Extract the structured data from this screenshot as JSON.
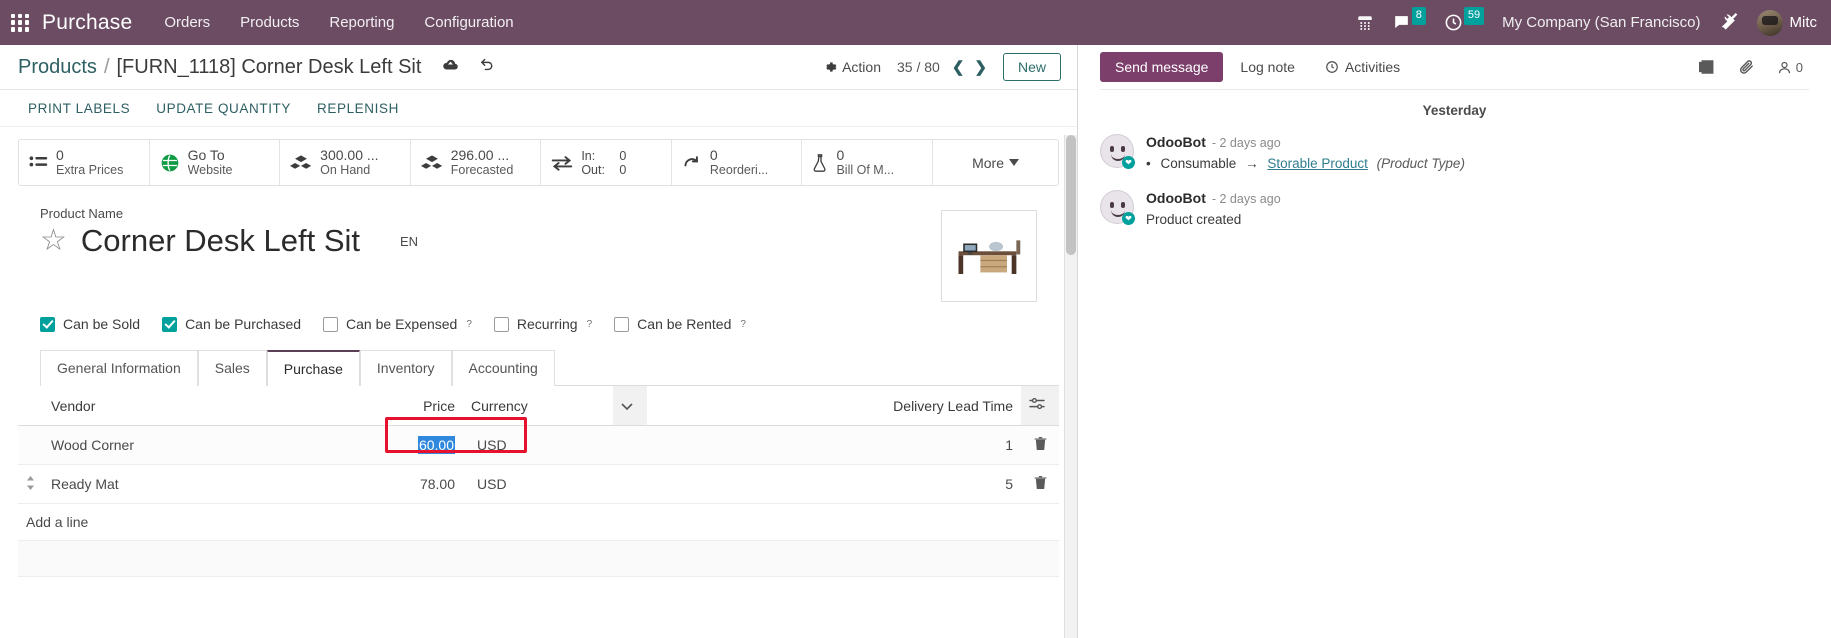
{
  "navbar": {
    "apps_icon": "apps-grid-icon",
    "brand": "Purchase",
    "menu": [
      {
        "label": "Orders"
      },
      {
        "label": "Products"
      },
      {
        "label": "Reporting"
      },
      {
        "label": "Configuration"
      }
    ],
    "phone_icon": "phone-icon",
    "messages_icon": "chat-bubble-icon",
    "messages_count": "8",
    "activities_icon": "clock-icon",
    "activities_count": "59",
    "company": "My Company (San Francisco)",
    "tools_icon": "wrench-screwdriver-icon",
    "avatar_icon": "user-avatar",
    "username": "Mitc"
  },
  "control_panel": {
    "breadcrumb_parent": "Products",
    "breadcrumb_sep": "/",
    "breadcrumb_current": "[FURN_1118] Corner Desk Left Sit",
    "save_icon": "cloud-upload-icon",
    "discard_icon": "undo-icon",
    "action_label": "Action",
    "action_icon": "gear-icon",
    "pager_value": "35 / 80",
    "prev_icon": "chevron-left-icon",
    "next_icon": "chevron-right-icon",
    "new_label": "New"
  },
  "statusbar_buttons": [
    {
      "label": "PRINT LABELS"
    },
    {
      "label": "UPDATE QUANTITY"
    },
    {
      "label": "REPLENISH"
    }
  ],
  "smart_buttons": [
    {
      "icon": "list-icon",
      "value": "0",
      "label": "Extra Prices"
    },
    {
      "icon": "globe-icon",
      "value": "Go To",
      "label": "Website"
    },
    {
      "icon": "boxes-icon",
      "value": "300.00 ...",
      "label": "On Hand"
    },
    {
      "icon": "boxes-icon",
      "value": "296.00 ...",
      "label": "Forecasted"
    },
    {
      "icon": "exchange-icon",
      "in_label": "In:",
      "in_value": "0",
      "out_label": "Out:",
      "out_value": "0"
    },
    {
      "icon": "refresh-icon",
      "value": "0",
      "label": "Reorderi..."
    },
    {
      "icon": "flask-icon",
      "value": "0",
      "label": "Bill Of M..."
    }
  ],
  "smart_more": {
    "label": "More",
    "icon": "caret-down-icon"
  },
  "product": {
    "name_label": "Product Name",
    "favorite_icon": "star-outline-icon",
    "name": "Corner Desk Left Sit",
    "language_badge": "EN",
    "image_alt": "product-photo-desk"
  },
  "checkboxes": [
    {
      "label": "Can be Sold",
      "checked": true,
      "help": ""
    },
    {
      "label": "Can be Purchased",
      "checked": true,
      "help": ""
    },
    {
      "label": "Can be Expensed",
      "checked": false,
      "help": "?"
    },
    {
      "label": "Recurring",
      "checked": false,
      "help": "?"
    },
    {
      "label": "Can be Rented",
      "checked": false,
      "help": "?"
    }
  ],
  "tabs": [
    {
      "label": "General Information",
      "active": false
    },
    {
      "label": "Sales",
      "active": false
    },
    {
      "label": "Purchase",
      "active": true
    },
    {
      "label": "Inventory",
      "active": false
    },
    {
      "label": "Accounting",
      "active": false
    }
  ],
  "vendor_list": {
    "headers": {
      "vendor": "Vendor",
      "price": "Price",
      "currency": "Currency",
      "optional_icon": "chevron-down-icon",
      "lead_time": "Delivery Lead Time",
      "settings_icon": "sliders-icon"
    },
    "rows": [
      {
        "handle_icon": "drag-handle-icon",
        "vendor": "Wood Corner",
        "price": "60.00",
        "price_selected": true,
        "currency": "USD",
        "lead_time": "1",
        "delete_icon": "trash-icon"
      },
      {
        "handle_icon": "drag-handle-icon",
        "vendor": "Ready Mat",
        "price": "78.00",
        "price_selected": false,
        "currency": "USD",
        "lead_time": "5",
        "delete_icon": "trash-icon"
      }
    ],
    "add_line_label": "Add a line"
  },
  "chatter": {
    "send_message": "Send message",
    "log_note": "Log note",
    "activities": "Activities",
    "activities_icon": "clock-plus-icon",
    "attachment_icon": "paperclip-icon",
    "note_icon": "notebook-icon",
    "followers_icon": "user-icon",
    "followers_count": "0",
    "day_separator": "Yesterday",
    "messages": [
      {
        "avatar": "odoobot-avatar",
        "author": "OdooBot",
        "time": "- 2 days ago",
        "type": "tracking",
        "bullet": "•",
        "old_value": "Consumable",
        "arrow": "→",
        "new_value": "Storable Product",
        "field": "(Product Type)"
      },
      {
        "avatar": "odoobot-avatar",
        "author": "OdooBot",
        "time": "- 2 days ago",
        "type": "text",
        "text": "Product created"
      }
    ]
  },
  "colors": {
    "navbar_bg": "#6B4C63",
    "accent_teal": "#00A09D",
    "link_teal": "#2E5F63",
    "primary_purple": "#7C3E6B",
    "highlight_red": "#E8112D",
    "selection_blue": "#2F87DE"
  }
}
